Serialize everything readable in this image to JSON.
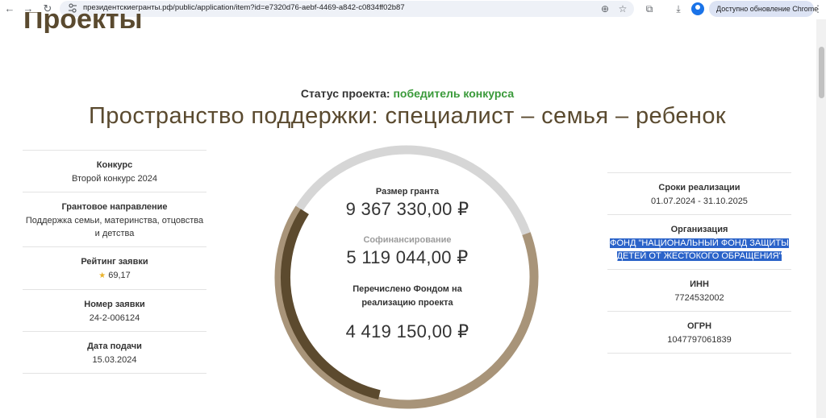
{
  "browser": {
    "url": "президентскиегранты.рф/public/application/item?id=e7320d76-aebf-4469-a842-c0834ff02b87",
    "update_label": "Доступно обновление Chrome"
  },
  "page": {
    "heading": "Проекты",
    "status_label": "Статус проекта:",
    "status_value": "победитель конкурса",
    "project_title": "Пространство поддержки: специалист – семья – ребенок"
  },
  "left_info": [
    {
      "label": "Конкурс",
      "value": "Второй конкурс 2024"
    },
    {
      "label": "Грантовое направление",
      "value": "Поддержка семьи, материнства, отцовства и детства"
    },
    {
      "label": "Рейтинг заявки",
      "value": "69,17"
    },
    {
      "label": "Номер заявки",
      "value": "24-2-006124"
    },
    {
      "label": "Дата подачи",
      "value": "15.03.2024"
    }
  ],
  "right_info": [
    {
      "label": "Сроки реализации",
      "value": "01.07.2024 - 31.10.2025"
    },
    {
      "label": "Организация",
      "value": "ФОНД \"НАЦИОНАЛЬНЫЙ ФОНД ЗАЩИТЫ ДЕТЕЙ ОТ ЖЕСТОКОГО ОБРАЩЕНИЯ\""
    },
    {
      "label": "ИНН",
      "value": "7724532002"
    },
    {
      "label": "ОГРН",
      "value": "1047797061839"
    }
  ],
  "finance": {
    "grant_label": "Размер гранта",
    "grant_value": "9 367 330,00 ₽",
    "cofin_label": "Софинансирование",
    "cofin_value": "5 119 044,00 ₽",
    "transferred_label": "Перечислено Фондом на реализацию проекта",
    "transferred_value": "4 419 150,00 ₽"
  },
  "ring_chart": {
    "total": 14486374,
    "segments": [
      {
        "value": 9367330,
        "color": "#a89479"
      },
      {
        "value": 5119044,
        "color": "#d6d6d6"
      }
    ],
    "inner_progress": {
      "value": 4419150,
      "color": "#5c4a2e"
    }
  }
}
